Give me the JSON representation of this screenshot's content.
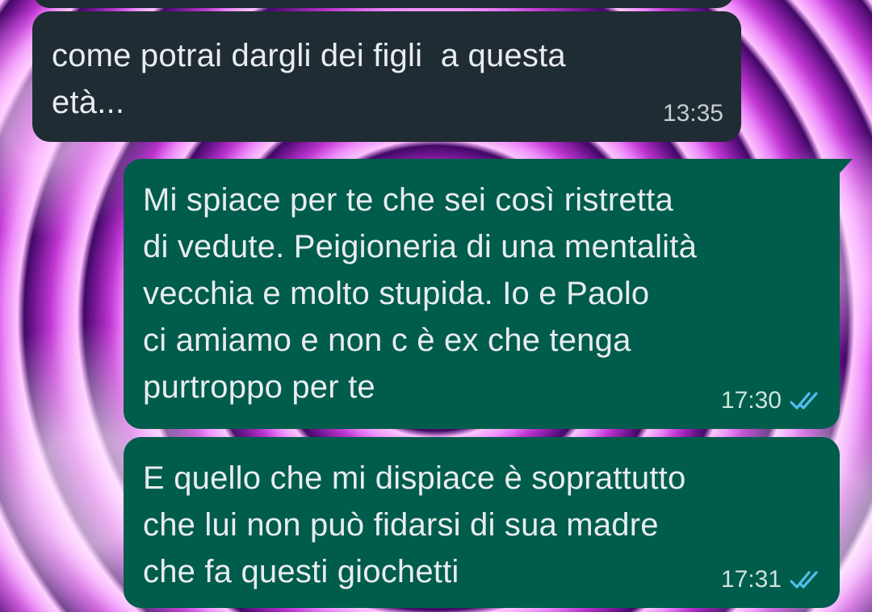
{
  "messages": [
    {
      "direction": "incoming",
      "text": "come potrai dargli dei figli  a questa\netà...",
      "time": "13:35"
    },
    {
      "direction": "outgoing",
      "text": "Mi spiace per te che sei così ristretta\ndi vedute. Peigioneria di una mentalità\nvecchia e molto stupida. Io e Paolo\nci amiamo e non c è ex che tenga\npurtroppo per te",
      "time": "17:30",
      "status_icon": "double-check-read-icon"
    },
    {
      "direction": "outgoing",
      "text": "E quello che mi dispiace è soprattutto\nche lui non può fidarsi di sua madre\nche fa questi giochetti",
      "time": "17:31",
      "status_icon": "double-check-read-icon"
    }
  ],
  "colors": {
    "incoming_bubble": "#202c33",
    "outgoing_bubble": "#005c4b",
    "read_tick": "#53bdeb",
    "text": "#e9edef"
  }
}
